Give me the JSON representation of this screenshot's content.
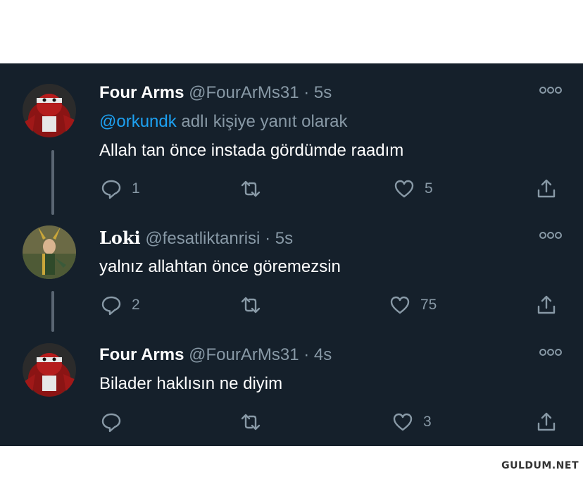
{
  "tweets": [
    {
      "name": "Four Arms",
      "handle": "@FourArMs31",
      "separator": "·",
      "time": "5s",
      "reply_prefix_mention": "@orkundk",
      "reply_suffix": "adlı kişiye yanıt olarak",
      "text": "Allah tan önce instada gördümde raadım",
      "replies": "1",
      "retweets": "",
      "likes": "5"
    },
    {
      "name": "Loki",
      "handle": "@fesatliktanrisi",
      "separator": "·",
      "time": "5s",
      "text": "yalnız allahtan önce göremezsin",
      "replies": "2",
      "retweets": "",
      "likes": "75"
    },
    {
      "name": "Four Arms",
      "handle": "@FourArMs31",
      "separator": "·",
      "time": "4s",
      "text": "Bilader haklısın ne diyim",
      "replies": "",
      "retweets": "",
      "likes": "3"
    }
  ],
  "watermark": "GULDUM.NET",
  "colors": {
    "background": "#15202b",
    "secondary_text": "#8899a6",
    "mention": "#1da1f2"
  },
  "icons": [
    "reply-icon",
    "retweet-icon",
    "like-icon",
    "share-icon",
    "more-icon"
  ]
}
